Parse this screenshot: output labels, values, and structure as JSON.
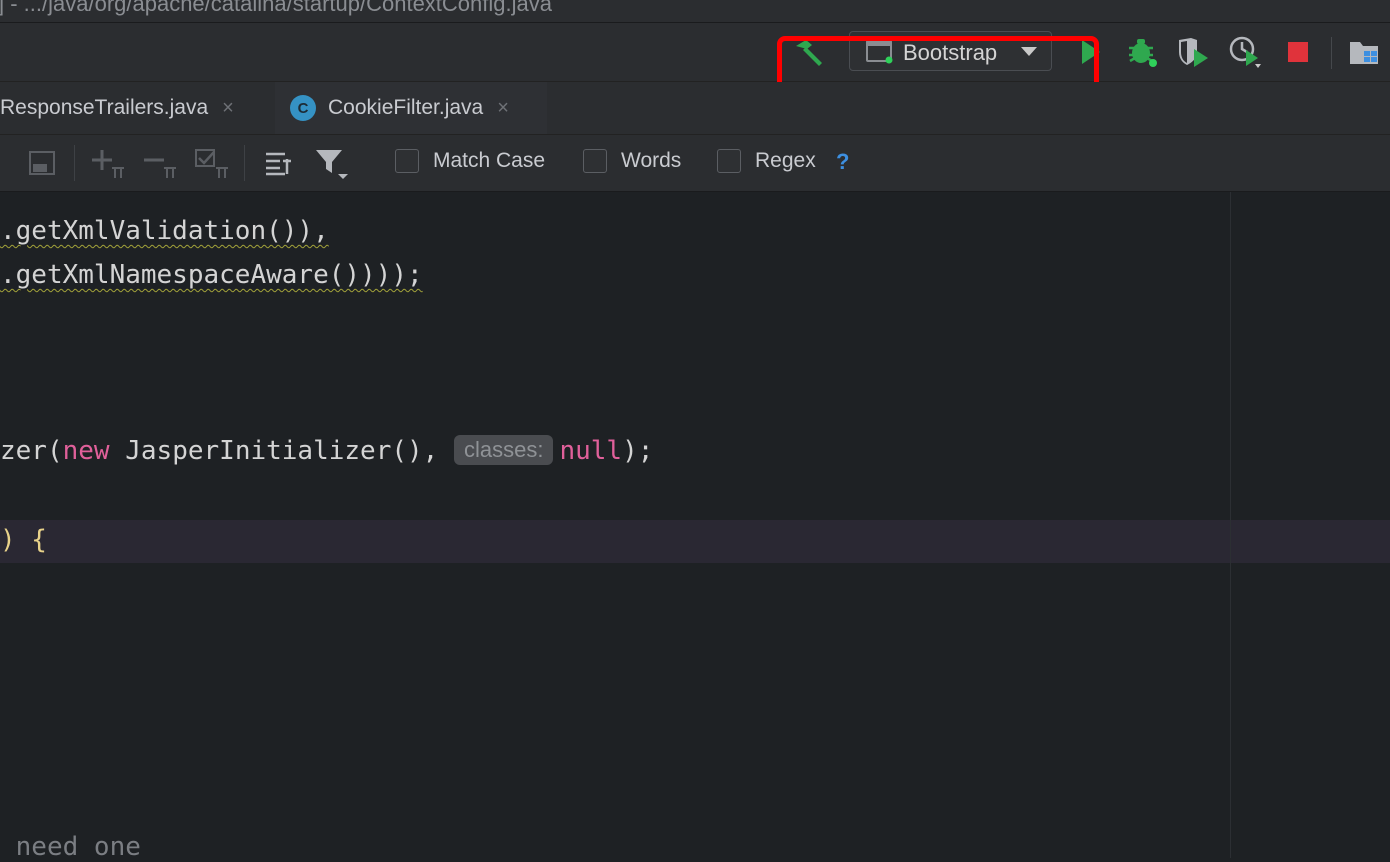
{
  "titlebar": {
    "path": "] - .../java/org/apache/catalina/startup/ContextConfig.java"
  },
  "toolbar": {
    "run_configuration": "Bootstrap",
    "icons": [
      "build-hammer-icon",
      "run-icon",
      "debug-icon",
      "coverage-icon",
      "profile-icon",
      "stop-icon",
      "project-structure-icon"
    ],
    "colors": {
      "green": "#2fa84f",
      "stop_red": "#e0333b",
      "highlight": "#ff0000"
    }
  },
  "tabs": [
    {
      "label": "ResponseTrailers.java",
      "close": "×"
    },
    {
      "label": "CookieFilter.java",
      "icon_letter": "C",
      "close": "×"
    }
  ],
  "findbar": {
    "options": [
      {
        "label": "Match Case",
        "checked": false
      },
      {
        "label": "Words",
        "checked": false
      },
      {
        "label": "Regex",
        "checked": false
      }
    ],
    "help": "?"
  },
  "code": {
    "line1": ".getXmlValidation()),",
    "line2": ".getXmlNamespaceAware())));",
    "line3_prefix": "zer(",
    "line3_kw": "new",
    "line3_mid": " JasperInitializer(), ",
    "line3_hint": "classes:",
    "line3_null": "null",
    "line3_end": ");",
    "line4": ") {",
    "line5": " need one"
  }
}
